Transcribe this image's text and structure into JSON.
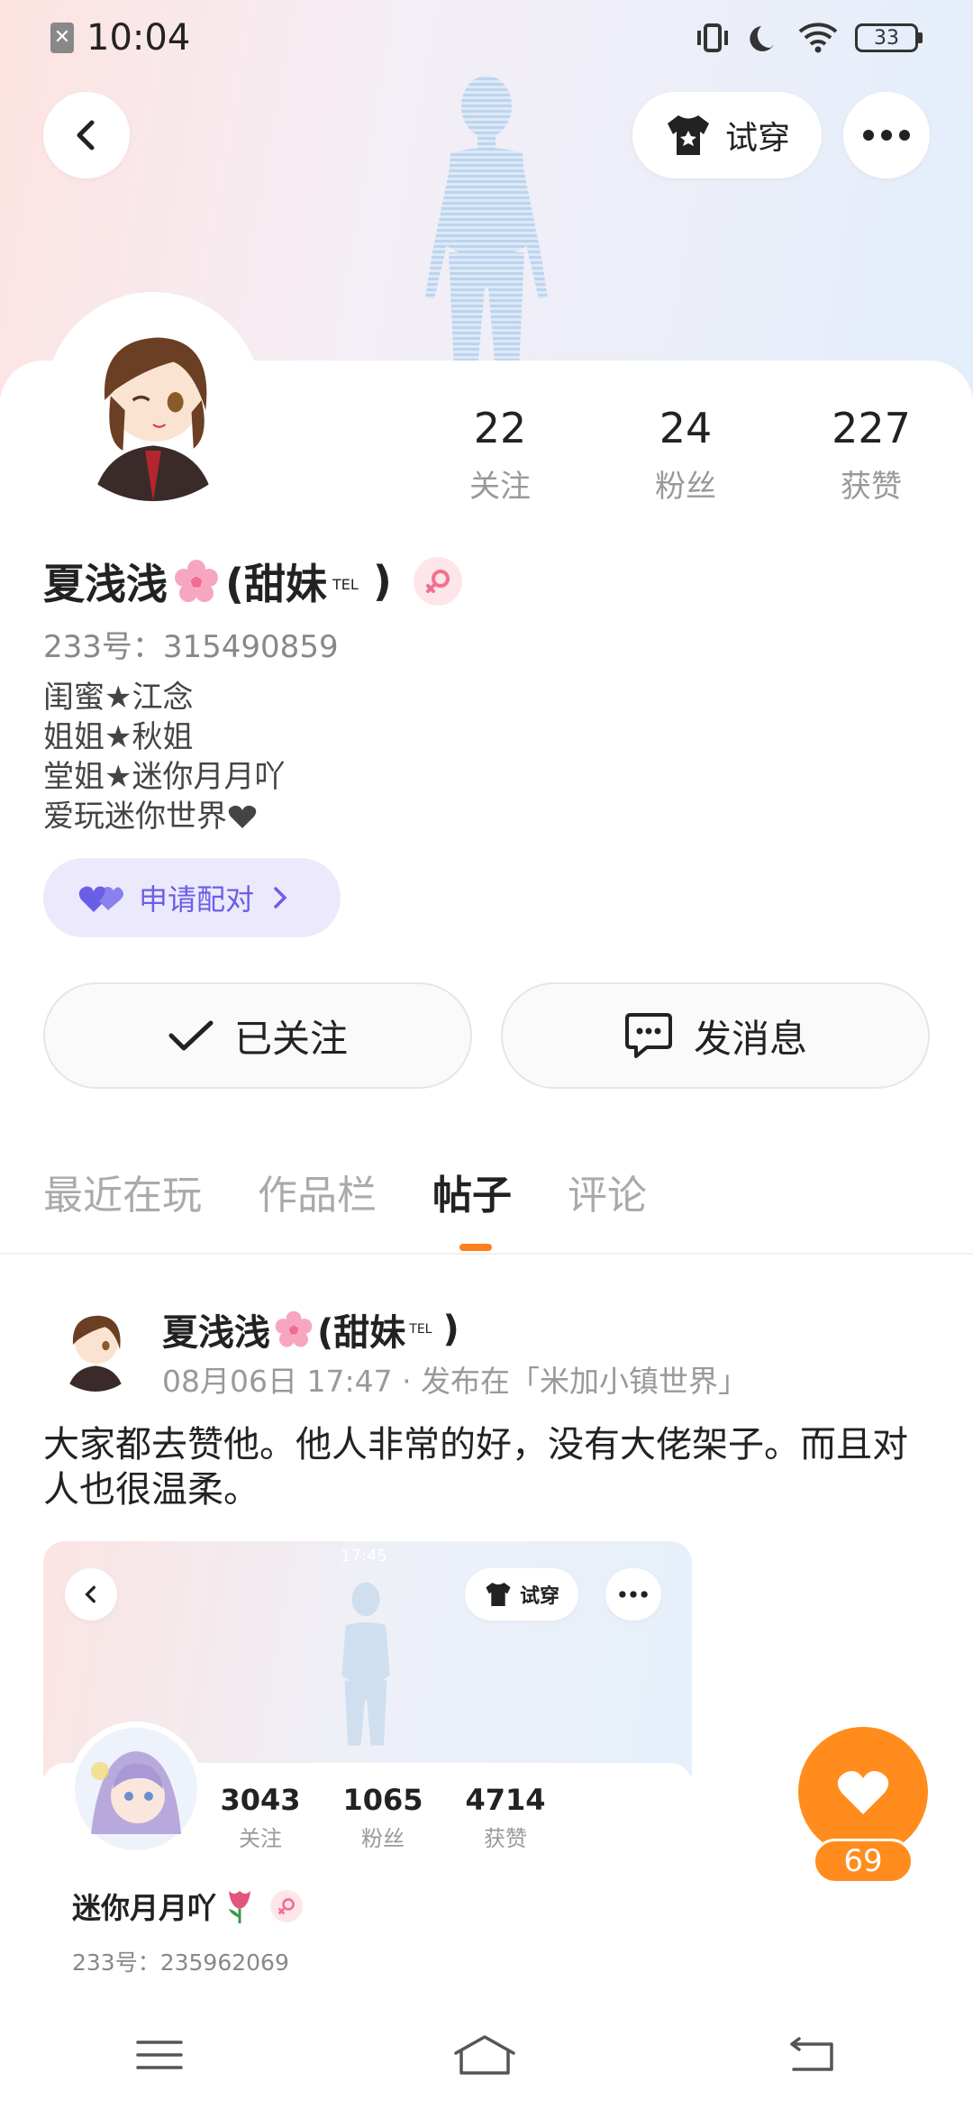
{
  "status": {
    "time": "10:04",
    "battery": "33"
  },
  "header": {
    "try_on_label": "试穿"
  },
  "profile": {
    "stats": [
      {
        "num": "22",
        "label": "关注"
      },
      {
        "num": "24",
        "label": "粉丝"
      },
      {
        "num": "227",
        "label": "获赞"
      }
    ],
    "name": "夏浅浅",
    "name_suffix": "(甜妹",
    "name_tag": "TEL",
    "name_close": ")",
    "id_line": "233号：315490859",
    "bio": [
      "闺蜜★江念",
      "姐姐★秋姐",
      "堂姐★迷你月月吖",
      "爱玩迷你世界"
    ],
    "pair_label": "申请配对"
  },
  "actions": {
    "follow_label": "已关注",
    "message_label": "发消息"
  },
  "tabs": [
    "最近在玩",
    "作品栏",
    "帖子",
    "评论"
  ],
  "active_tab": 2,
  "post": {
    "author": "夏浅浅",
    "author_suffix": "(甜妹",
    "author_tag": "TEL",
    "author_close": ")",
    "meta": "08月06日 17:47 · 发布在「米加小镇世界」",
    "text": "大家都去赞他。他人非常的好，没有大佬架子。而且对人也很温柔。",
    "embed": {
      "status_time": "17:45",
      "try_on_label": "试穿",
      "stats": [
        {
          "num": "3043",
          "label": "关注"
        },
        {
          "num": "1065",
          "label": "粉丝"
        },
        {
          "num": "4714",
          "label": "获赞"
        }
      ],
      "name": "迷你月月吖",
      "id_line": "233号：235962069"
    },
    "like_count": "69"
  },
  "colors": {
    "accent": "#ff7e1c",
    "like": "#ff8c1c",
    "pair_bg": "#ece9fc",
    "pair_text": "#6b5ee6"
  }
}
